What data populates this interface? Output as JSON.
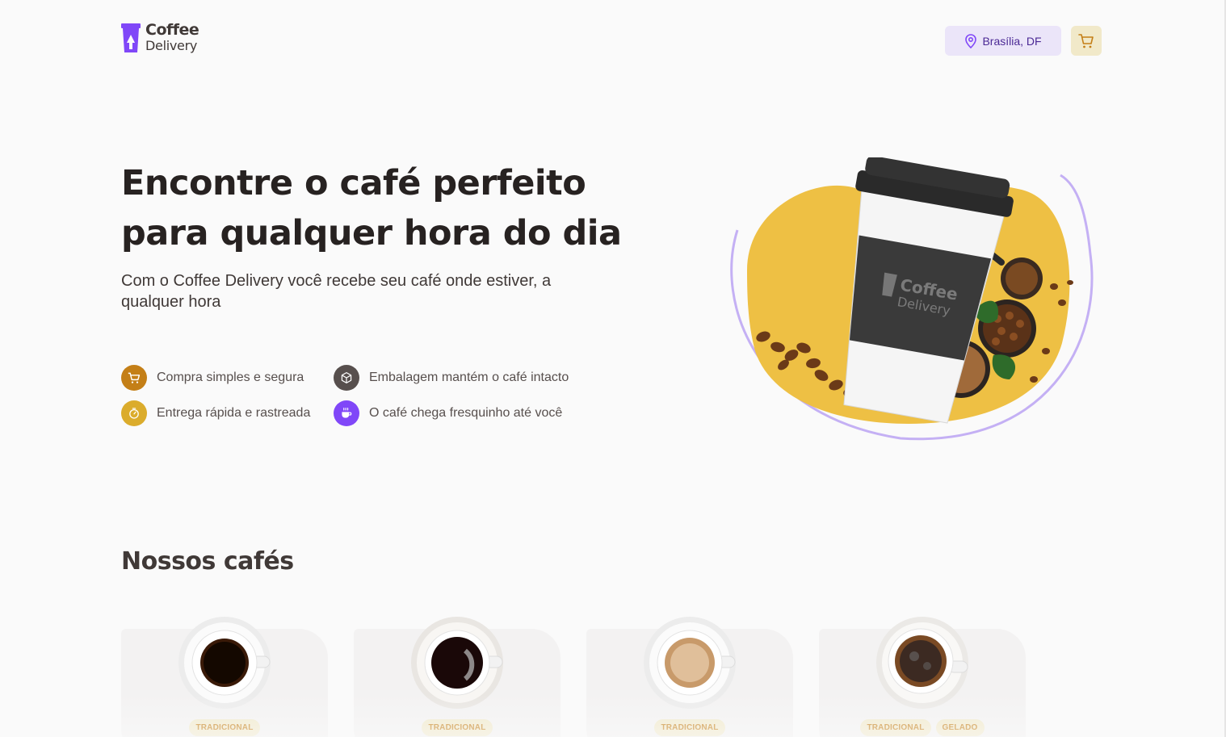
{
  "header": {
    "logo_word1": "Coffee",
    "logo_word2": "Delivery",
    "location_label": "Brasília, DF",
    "location_icon": "map-pin-icon",
    "cart_icon": "shopping-cart-icon"
  },
  "hero": {
    "title_line1": "Encontre o café perfeito",
    "title_line2": "para qualquer hora do dia",
    "subtitle": "Com o Coffee Delivery você recebe seu café onde estiver, a qualquer hora",
    "image_cup_brand_1": "Coffee",
    "image_cup_brand_2": "Delivery",
    "features": [
      {
        "label": "Compra simples e segura",
        "icon": "shopping-cart-icon",
        "color": "#c47f17"
      },
      {
        "label": "Embalagem mantém o café intacto",
        "icon": "package-icon",
        "color": "#574f4d"
      },
      {
        "label": "Entrega rápida e rastreada",
        "icon": "timer-icon",
        "color": "#dbac2c"
      },
      {
        "label": "O café chega fresquinho até você",
        "icon": "coffee-icon",
        "color": "#8047f8"
      }
    ]
  },
  "section": {
    "title": "Nossos cafés"
  },
  "coffees": [
    {
      "tags": [
        "TRADICIONAL"
      ],
      "image": "espresso-cup"
    },
    {
      "tags": [
        "TRADICIONAL"
      ],
      "image": "americano-cup"
    },
    {
      "tags": [
        "TRADICIONAL"
      ],
      "image": "cremoso-cup"
    },
    {
      "tags": [
        "TRADICIONAL",
        "GELADO"
      ],
      "image": "gelado-cup"
    }
  ],
  "colors": {
    "background": "#fafafa",
    "purple": "#8047f8",
    "purple_dark": "#4b2995",
    "purple_light": "#ebe5f9",
    "yellow": "#dbac2c",
    "yellow_dark": "#c47f17",
    "yellow_light": "#f1e9c9"
  }
}
